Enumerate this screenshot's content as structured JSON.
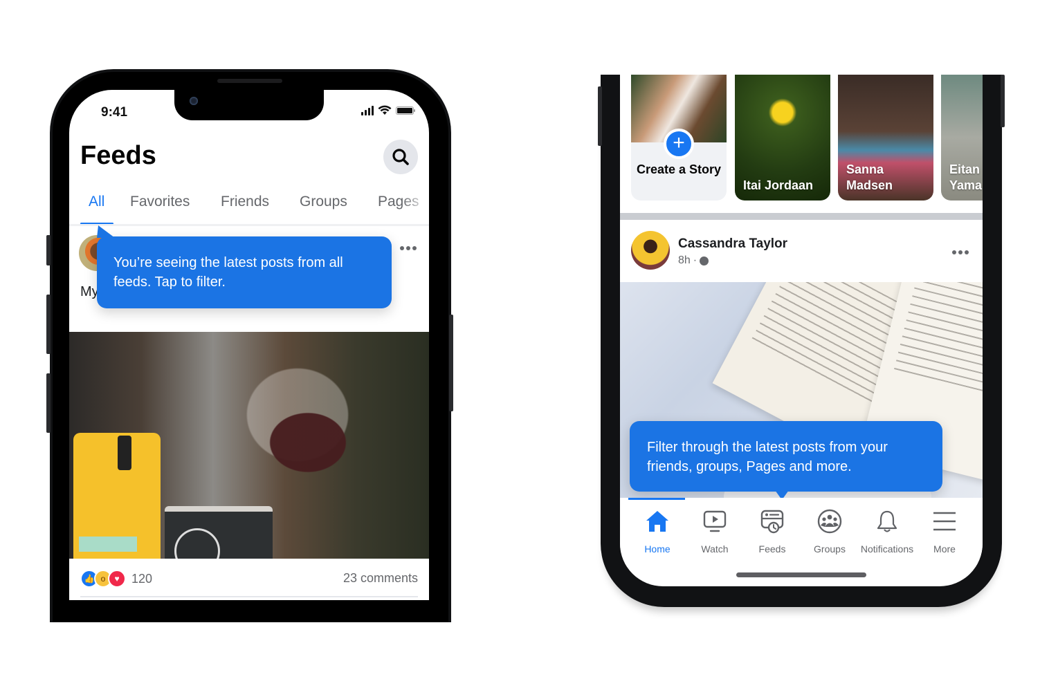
{
  "left_phone": {
    "status_bar": {
      "time": "9:41"
    },
    "header": {
      "title": "Feeds",
      "search_icon": "search-icon"
    },
    "tabs": [
      {
        "label": "All",
        "active": true
      },
      {
        "label": "Favorites",
        "active": false
      },
      {
        "label": "Friends",
        "active": false
      },
      {
        "label": "Groups",
        "active": false
      },
      {
        "label": "Pages",
        "active": false
      }
    ],
    "tooltip": {
      "text": "You’re seeing the latest posts from all feeds. Tap to filter."
    },
    "post": {
      "text": "My coffee",
      "reactions": [
        "like",
        "wow",
        "love"
      ],
      "reaction_count": "120",
      "comments": "23 comments"
    }
  },
  "right_phone": {
    "stories": [
      {
        "label": "Create a Story",
        "type": "create"
      },
      {
        "label": "Itai Jordaan"
      },
      {
        "label": "Sanna Madsen"
      },
      {
        "label": "Eitan Yama"
      }
    ],
    "post": {
      "author": "Cassandra Taylor",
      "time": "8h",
      "separator": "·",
      "privacy_icon": "globe-icon"
    },
    "tooltip": {
      "text": "Filter through the latest posts from your friends, groups, Pages and more."
    },
    "nav": [
      {
        "label": "Home",
        "icon": "home-icon",
        "active": true
      },
      {
        "label": "Watch",
        "icon": "watch-icon",
        "active": false
      },
      {
        "label": "Feeds",
        "icon": "feeds-icon",
        "active": false
      },
      {
        "label": "Groups",
        "icon": "groups-icon",
        "active": false
      },
      {
        "label": "Notifications",
        "icon": "bell-icon",
        "active": false
      },
      {
        "label": "More",
        "icon": "menu-icon",
        "active": false
      }
    ]
  },
  "colors": {
    "accent": "#1877f2",
    "tooltip": "#1b74e4",
    "secondary_text": "#65676b"
  }
}
